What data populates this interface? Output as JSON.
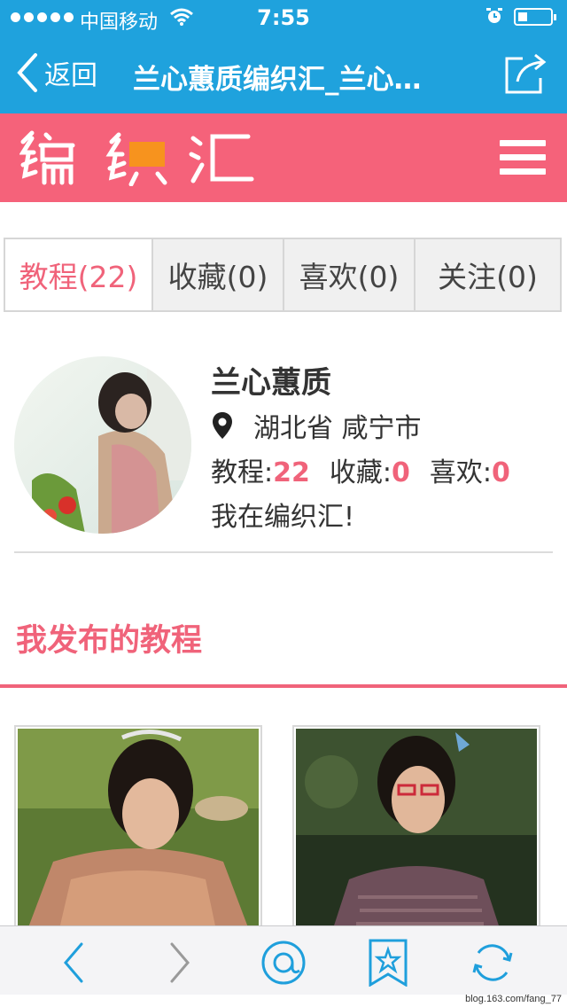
{
  "status_bar": {
    "carrier": "中国移动",
    "time": "7:55"
  },
  "nav": {
    "back_label": "返回",
    "title": "兰心蕙质编织汇_兰心蕙质"
  },
  "brand": {
    "logo_text": "编织汇",
    "color": "#f5627a"
  },
  "tabs": [
    {
      "label": "教程(22)",
      "active": true
    },
    {
      "label": "收藏(0)",
      "active": false
    },
    {
      "label": "喜欢(0)",
      "active": false
    },
    {
      "label": "关注(0)",
      "active": false
    }
  ],
  "profile": {
    "name": "兰心蕙质",
    "location": "湖北省 咸宁市",
    "stats": [
      {
        "label": "教程:",
        "value": "22"
      },
      {
        "label": "收藏:",
        "value": "0"
      },
      {
        "label": "喜欢:",
        "value": "0"
      }
    ],
    "bio": "我在编织汇!"
  },
  "section": {
    "title": "我发布的教程"
  },
  "toolbar": {
    "icons": [
      "chevron-left-icon",
      "chevron-right-icon",
      "at-icon",
      "bookmark-star-icon",
      "refresh-icon"
    ]
  },
  "watermark": "blog.163.com/fang_77",
  "colors": {
    "accent": "#f0637a",
    "nav_bar": "#1fa2dd",
    "toolbar_icon": "#1f9fdc"
  }
}
